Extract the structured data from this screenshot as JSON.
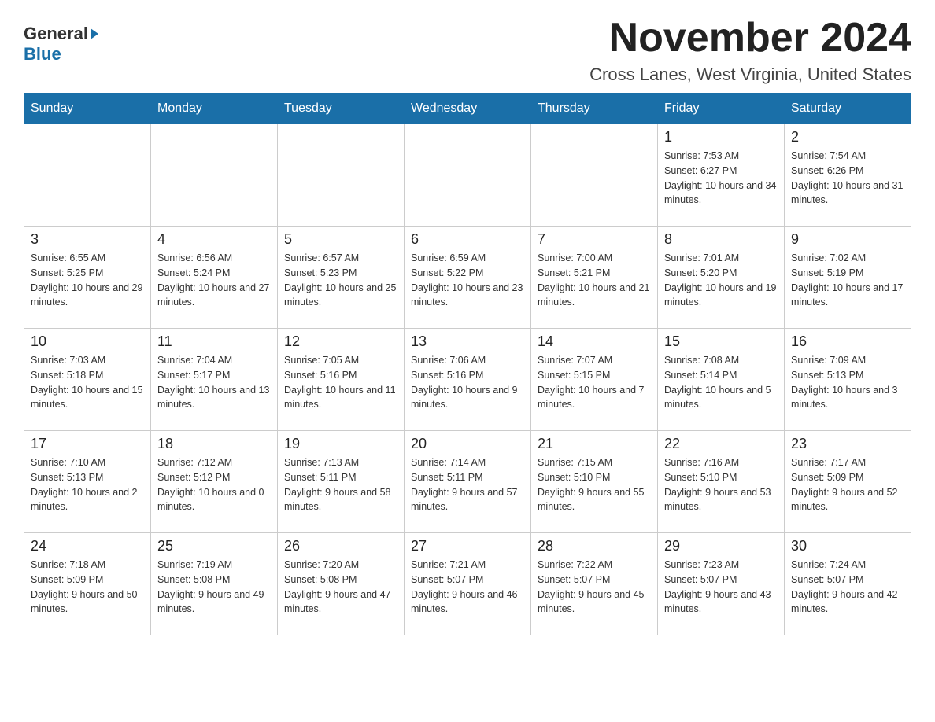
{
  "header": {
    "logo_general": "General",
    "logo_blue": "Blue",
    "month_title": "November 2024",
    "location": "Cross Lanes, West Virginia, United States"
  },
  "weekdays": [
    "Sunday",
    "Monday",
    "Tuesday",
    "Wednesday",
    "Thursday",
    "Friday",
    "Saturday"
  ],
  "weeks": [
    [
      {
        "day": "",
        "sunrise": "",
        "sunset": "",
        "daylight": ""
      },
      {
        "day": "",
        "sunrise": "",
        "sunset": "",
        "daylight": ""
      },
      {
        "day": "",
        "sunrise": "",
        "sunset": "",
        "daylight": ""
      },
      {
        "day": "",
        "sunrise": "",
        "sunset": "",
        "daylight": ""
      },
      {
        "day": "",
        "sunrise": "",
        "sunset": "",
        "daylight": ""
      },
      {
        "day": "1",
        "sunrise": "Sunrise: 7:53 AM",
        "sunset": "Sunset: 6:27 PM",
        "daylight": "Daylight: 10 hours and 34 minutes."
      },
      {
        "day": "2",
        "sunrise": "Sunrise: 7:54 AM",
        "sunset": "Sunset: 6:26 PM",
        "daylight": "Daylight: 10 hours and 31 minutes."
      }
    ],
    [
      {
        "day": "3",
        "sunrise": "Sunrise: 6:55 AM",
        "sunset": "Sunset: 5:25 PM",
        "daylight": "Daylight: 10 hours and 29 minutes."
      },
      {
        "day": "4",
        "sunrise": "Sunrise: 6:56 AM",
        "sunset": "Sunset: 5:24 PM",
        "daylight": "Daylight: 10 hours and 27 minutes."
      },
      {
        "day": "5",
        "sunrise": "Sunrise: 6:57 AM",
        "sunset": "Sunset: 5:23 PM",
        "daylight": "Daylight: 10 hours and 25 minutes."
      },
      {
        "day": "6",
        "sunrise": "Sunrise: 6:59 AM",
        "sunset": "Sunset: 5:22 PM",
        "daylight": "Daylight: 10 hours and 23 minutes."
      },
      {
        "day": "7",
        "sunrise": "Sunrise: 7:00 AM",
        "sunset": "Sunset: 5:21 PM",
        "daylight": "Daylight: 10 hours and 21 minutes."
      },
      {
        "day": "8",
        "sunrise": "Sunrise: 7:01 AM",
        "sunset": "Sunset: 5:20 PM",
        "daylight": "Daylight: 10 hours and 19 minutes."
      },
      {
        "day": "9",
        "sunrise": "Sunrise: 7:02 AM",
        "sunset": "Sunset: 5:19 PM",
        "daylight": "Daylight: 10 hours and 17 minutes."
      }
    ],
    [
      {
        "day": "10",
        "sunrise": "Sunrise: 7:03 AM",
        "sunset": "Sunset: 5:18 PM",
        "daylight": "Daylight: 10 hours and 15 minutes."
      },
      {
        "day": "11",
        "sunrise": "Sunrise: 7:04 AM",
        "sunset": "Sunset: 5:17 PM",
        "daylight": "Daylight: 10 hours and 13 minutes."
      },
      {
        "day": "12",
        "sunrise": "Sunrise: 7:05 AM",
        "sunset": "Sunset: 5:16 PM",
        "daylight": "Daylight: 10 hours and 11 minutes."
      },
      {
        "day": "13",
        "sunrise": "Sunrise: 7:06 AM",
        "sunset": "Sunset: 5:16 PM",
        "daylight": "Daylight: 10 hours and 9 minutes."
      },
      {
        "day": "14",
        "sunrise": "Sunrise: 7:07 AM",
        "sunset": "Sunset: 5:15 PM",
        "daylight": "Daylight: 10 hours and 7 minutes."
      },
      {
        "day": "15",
        "sunrise": "Sunrise: 7:08 AM",
        "sunset": "Sunset: 5:14 PM",
        "daylight": "Daylight: 10 hours and 5 minutes."
      },
      {
        "day": "16",
        "sunrise": "Sunrise: 7:09 AM",
        "sunset": "Sunset: 5:13 PM",
        "daylight": "Daylight: 10 hours and 3 minutes."
      }
    ],
    [
      {
        "day": "17",
        "sunrise": "Sunrise: 7:10 AM",
        "sunset": "Sunset: 5:13 PM",
        "daylight": "Daylight: 10 hours and 2 minutes."
      },
      {
        "day": "18",
        "sunrise": "Sunrise: 7:12 AM",
        "sunset": "Sunset: 5:12 PM",
        "daylight": "Daylight: 10 hours and 0 minutes."
      },
      {
        "day": "19",
        "sunrise": "Sunrise: 7:13 AM",
        "sunset": "Sunset: 5:11 PM",
        "daylight": "Daylight: 9 hours and 58 minutes."
      },
      {
        "day": "20",
        "sunrise": "Sunrise: 7:14 AM",
        "sunset": "Sunset: 5:11 PM",
        "daylight": "Daylight: 9 hours and 57 minutes."
      },
      {
        "day": "21",
        "sunrise": "Sunrise: 7:15 AM",
        "sunset": "Sunset: 5:10 PM",
        "daylight": "Daylight: 9 hours and 55 minutes."
      },
      {
        "day": "22",
        "sunrise": "Sunrise: 7:16 AM",
        "sunset": "Sunset: 5:10 PM",
        "daylight": "Daylight: 9 hours and 53 minutes."
      },
      {
        "day": "23",
        "sunrise": "Sunrise: 7:17 AM",
        "sunset": "Sunset: 5:09 PM",
        "daylight": "Daylight: 9 hours and 52 minutes."
      }
    ],
    [
      {
        "day": "24",
        "sunrise": "Sunrise: 7:18 AM",
        "sunset": "Sunset: 5:09 PM",
        "daylight": "Daylight: 9 hours and 50 minutes."
      },
      {
        "day": "25",
        "sunrise": "Sunrise: 7:19 AM",
        "sunset": "Sunset: 5:08 PM",
        "daylight": "Daylight: 9 hours and 49 minutes."
      },
      {
        "day": "26",
        "sunrise": "Sunrise: 7:20 AM",
        "sunset": "Sunset: 5:08 PM",
        "daylight": "Daylight: 9 hours and 47 minutes."
      },
      {
        "day": "27",
        "sunrise": "Sunrise: 7:21 AM",
        "sunset": "Sunset: 5:07 PM",
        "daylight": "Daylight: 9 hours and 46 minutes."
      },
      {
        "day": "28",
        "sunrise": "Sunrise: 7:22 AM",
        "sunset": "Sunset: 5:07 PM",
        "daylight": "Daylight: 9 hours and 45 minutes."
      },
      {
        "day": "29",
        "sunrise": "Sunrise: 7:23 AM",
        "sunset": "Sunset: 5:07 PM",
        "daylight": "Daylight: 9 hours and 43 minutes."
      },
      {
        "day": "30",
        "sunrise": "Sunrise: 7:24 AM",
        "sunset": "Sunset: 5:07 PM",
        "daylight": "Daylight: 9 hours and 42 minutes."
      }
    ]
  ]
}
